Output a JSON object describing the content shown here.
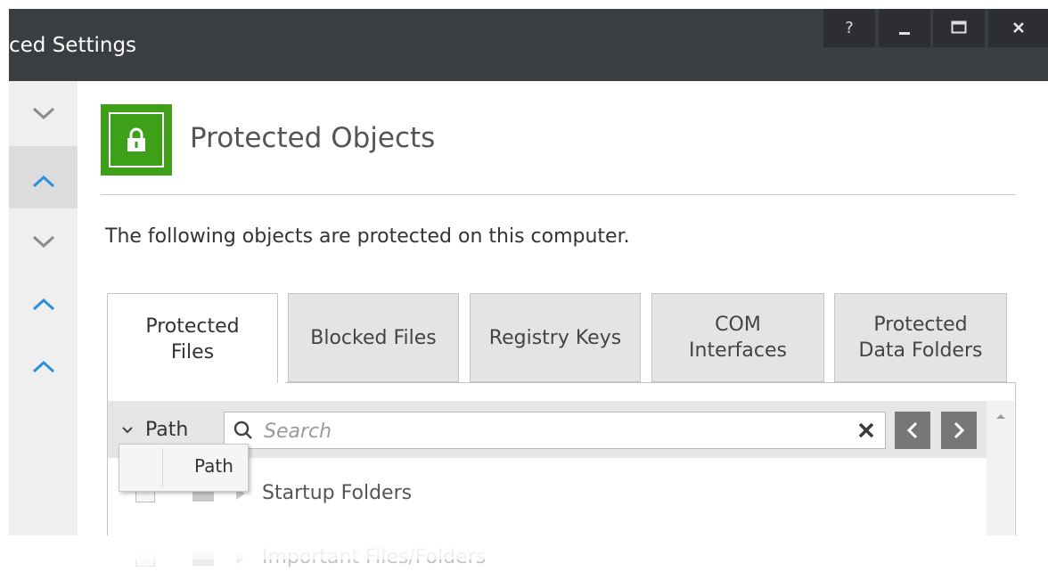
{
  "window": {
    "title": "ced Settings",
    "help_label": "?",
    "minimize_label": "–",
    "maximize_label": "□",
    "close_label": "✕"
  },
  "header": {
    "icon": "lock-icon",
    "title": "Protected Objects",
    "accent_color": "#3da018"
  },
  "description": "The following objects are protected on this computer.",
  "tabs": [
    {
      "label_line1": "Protected",
      "label_line2": "Files",
      "active": true
    },
    {
      "label_line1": "Blocked Files",
      "label_line2": "",
      "active": false
    },
    {
      "label_line1": "Registry Keys",
      "label_line2": "",
      "active": false
    },
    {
      "label_line1": "COM",
      "label_line2": "Interfaces",
      "active": false
    },
    {
      "label_line1": "Protected",
      "label_line2": "Data Folders",
      "active": false
    }
  ],
  "toolbar": {
    "column_label": "Path",
    "search_placeholder": "Search",
    "clear_icon": "close-icon",
    "prev_icon": "chevron-left-icon",
    "next_icon": "chevron-right-icon"
  },
  "dropdown": {
    "item": "Path"
  },
  "rows": [
    {
      "label": "Startup Folders"
    },
    {
      "label": "Important Files/Folders"
    }
  ],
  "sidebar": {
    "icons": [
      "chevron-down-icon",
      "chevron-up-icon",
      "chevron-down-icon",
      "chevron-up-icon",
      "chevron-up-icon"
    ]
  },
  "colors": {
    "titlebar": "#3a3d42",
    "chevron_blue": "#2e8fd8",
    "chevron_gray": "#8a8a8a"
  }
}
